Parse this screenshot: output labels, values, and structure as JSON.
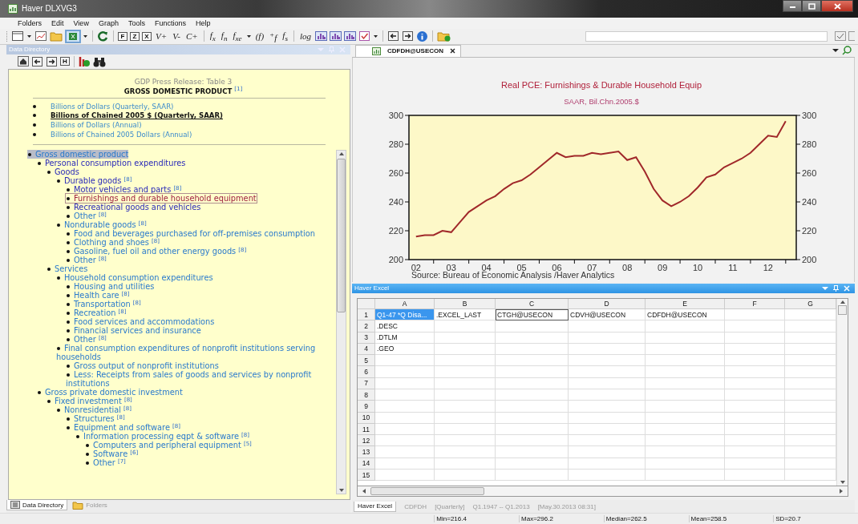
{
  "window": {
    "title": "Haver DLXVG3"
  },
  "menu": [
    "Folders",
    "Edit",
    "View",
    "Graph",
    "Tools",
    "Functions",
    "Help"
  ],
  "toolbar": [
    {
      "kind": "doc"
    },
    {
      "kind": "caret"
    },
    {
      "kind": "chart"
    },
    {
      "kind": "folder"
    },
    {
      "kind": "sheet"
    },
    {
      "kind": "caret"
    },
    {
      "kind": "sep"
    },
    {
      "kind": "refresh"
    },
    {
      "kind": "sep"
    },
    {
      "kind": "boxed",
      "label": "F"
    },
    {
      "kind": "boxed",
      "label": "Z"
    },
    {
      "kind": "boxed",
      "label": "X"
    },
    {
      "kind": "text",
      "label": "V+"
    },
    {
      "kind": "text",
      "label": "V-"
    },
    {
      "kind": "text",
      "label": "C+"
    },
    {
      "kind": "sep"
    },
    {
      "kind": "text",
      "label": "f$_{x}$"
    },
    {
      "kind": "text",
      "label": "f$_{n}$"
    },
    {
      "kind": "text",
      "label": "f$_{xe}$"
    },
    {
      "kind": "caret"
    },
    {
      "kind": "text",
      "label": "(f)"
    },
    {
      "kind": "text",
      "label": "$^{+}$f"
    },
    {
      "kind": "text",
      "label": "f$_{s}$"
    },
    {
      "kind": "sep"
    },
    {
      "kind": "text",
      "label": "log"
    },
    {
      "kind": "bars"
    },
    {
      "kind": "bars"
    },
    {
      "kind": "bars"
    },
    {
      "kind": "check"
    },
    {
      "kind": "caret"
    },
    {
      "kind": "sep"
    },
    {
      "kind": "left"
    },
    {
      "kind": "right"
    },
    {
      "kind": "info"
    },
    {
      "kind": "sep"
    },
    {
      "kind": "add-folder"
    }
  ],
  "data_directory": {
    "title": "Data Directory",
    "nav": [
      {
        "kind": "home"
      },
      {
        "kind": "left"
      },
      {
        "kind": "right"
      },
      {
        "kind": "boxed",
        "label": "H"
      },
      {
        "kind": "sep"
      },
      {
        "kind": "chart-add"
      },
      {
        "kind": "binoculars"
      }
    ],
    "release": "GDP Press Release: Table 3",
    "heading": "GROSS DOMESTIC PRODUCT $^{[1]}$",
    "units": [
      {
        "label": "Billions of Dollars (Quarterly, SAAR)",
        "selected": false
      },
      {
        "label": "Billions of Chained 2005 $ (Quarterly, SAAR)",
        "selected": true
      },
      {
        "label": "Billions of Dollars (Annual)",
        "selected": false
      },
      {
        "label": "Billions of Chained 2005 Dollars (Annual)",
        "selected": false
      }
    ],
    "tree": [
      {
        "label": "Gross domestic product",
        "selected": true,
        "current": false,
        "visited": false,
        "children": [
          {
            "label": "Personal consumption expenditures",
            "selected": false,
            "current": false,
            "visited": true,
            "children": [
              {
                "label": "Goods",
                "selected": false,
                "current": false,
                "visited": true,
                "children": [
                  {
                    "label": "Durable goods $^{[8]}$",
                    "selected": false,
                    "current": false,
                    "visited": true,
                    "children": [
                      {
                        "label": "Motor vehicles and parts $^{[8]}$",
                        "selected": false,
                        "current": false,
                        "visited": true
                      },
                      {
                        "label": "Furnishings and durable household equipment",
                        "selected": false,
                        "current": true,
                        "visited": true
                      },
                      {
                        "label": "Recreational goods and vehicles",
                        "selected": false,
                        "current": false,
                        "visited": true
                      },
                      {
                        "label": "Other $^{[8]}$",
                        "selected": false,
                        "current": false,
                        "visited": false
                      }
                    ]
                  },
                  {
                    "label": "Nondurable goods $^{[8]}$",
                    "selected": false,
                    "current": false,
                    "visited": false,
                    "children": [
                      {
                        "label": "Food and beverages purchased for off-premises consumption",
                        "selected": false,
                        "current": false,
                        "visited": false
                      },
                      {
                        "label": "Clothing and shoes $^{[8]}$",
                        "selected": false,
                        "current": false,
                        "visited": false
                      },
                      {
                        "label": "Gasoline, fuel oil and other energy goods $^{[8]}$",
                        "selected": false,
                        "current": false,
                        "visited": false
                      },
                      {
                        "label": "Other $^{[8]}$",
                        "selected": false,
                        "current": false,
                        "visited": false
                      }
                    ]
                  }
                ]
              },
              {
                "label": "Services",
                "selected": false,
                "current": false,
                "visited": false,
                "children": [
                  {
                    "label": "Household consumption expenditures",
                    "selected": false,
                    "current": false,
                    "visited": false,
                    "children": [
                      {
                        "label": "Housing and utilities",
                        "selected": false,
                        "current": false,
                        "visited": false
                      },
                      {
                        "label": "Health care $^{[8]}$",
                        "selected": false,
                        "current": false,
                        "visited": false
                      },
                      {
                        "label": "Transportation $^{[8]}$",
                        "selected": false,
                        "current": false,
                        "visited": false
                      },
                      {
                        "label": "Recreation $^{[8]}$",
                        "selected": false,
                        "current": false,
                        "visited": false
                      },
                      {
                        "label": "Food services and accommodations",
                        "selected": false,
                        "current": false,
                        "visited": false
                      },
                      {
                        "label": "Financial services and insurance",
                        "selected": false,
                        "current": false,
                        "visited": false
                      },
                      {
                        "label": "Other $^{[8]}$",
                        "selected": false,
                        "current": false,
                        "visited": false
                      }
                    ]
                  },
                  {
                    "label": "Final consumption expenditures of nonprofit institutions serving households",
                    "selected": false,
                    "current": false,
                    "visited": false,
                    "children": [
                      {
                        "label": "Gross output of nonprofit institutions",
                        "selected": false,
                        "current": false,
                        "visited": false
                      },
                      {
                        "label": "Less: Receipts from sales of goods and services by nonprofit institutions",
                        "selected": false,
                        "current": false,
                        "visited": false
                      }
                    ]
                  }
                ]
              }
            ]
          },
          {
            "label": "Gross private domestic investment",
            "selected": false,
            "current": false,
            "visited": false,
            "children": [
              {
                "label": "Fixed investment $^{[8]}$",
                "selected": false,
                "current": false,
                "visited": false,
                "children": [
                  {
                    "label": "Nonresidential $^{[8]}$",
                    "selected": false,
                    "current": false,
                    "visited": false,
                    "children": [
                      {
                        "label": "Structures $^{[8]}$",
                        "selected": false,
                        "current": false,
                        "visited": false
                      },
                      {
                        "label": "Equipment and software $^{[8]}$",
                        "selected": false,
                        "current": false,
                        "visited": false,
                        "children": [
                          {
                            "label": "Information processing eqpt & software $^{[8]}$",
                            "selected": false,
                            "current": false,
                            "visited": false,
                            "children": [
                              {
                                "label": "Computers and peripheral equipment $^{[5]}$",
                                "selected": false,
                                "current": false,
                                "visited": false
                              },
                              {
                                "label": "Software $^{[6]}$",
                                "selected": false,
                                "current": false,
                                "visited": false
                              },
                              {
                                "label": "Other $^{[7]}$",
                                "selected": false,
                                "current": false,
                                "visited": false
                              }
                            ]
                          }
                        ]
                      }
                    ]
                  }
                ]
              }
            ]
          }
        ]
      }
    ],
    "tabs": [
      {
        "label": "Data Directory",
        "kind": "list",
        "selected": true
      },
      {
        "label": "Folders",
        "kind": "folder",
        "selected": false
      }
    ]
  },
  "chart_tab": {
    "label": "CDFDH@USECON"
  },
  "chart": {
    "subtitle": "SAAR, Bil.Chn.2005.$",
    "source": "Source:  Bureau of Economic Analysis /Haver Analytics",
    "chart_data": {
      "type": "line",
      "title": "Real PCE: Furnishings & Durable Household Equip",
      "x": [
        2,
        2.25,
        2.5,
        2.75,
        3,
        3.25,
        3.5,
        3.75,
        4,
        4.25,
        4.5,
        4.75,
        5,
        5.25,
        5.5,
        5.75,
        6,
        6.25,
        6.5,
        6.75,
        7,
        7.25,
        7.5,
        7.75,
        8,
        8.25,
        8.5,
        8.75,
        9,
        9.25,
        9.5,
        9.75,
        10,
        10.25,
        10.5,
        10.75,
        11,
        11.25,
        11.5,
        11.75,
        12,
        12.25,
        12.5
      ],
      "series": [
        {
          "color": "#a0282a",
          "values": [
            216,
            217,
            217,
            220,
            219,
            226,
            233,
            237,
            241,
            244,
            249,
            253,
            255,
            259,
            264,
            269,
            274,
            271,
            272,
            272,
            274,
            273,
            274,
            275,
            269,
            271,
            261,
            249,
            241,
            237,
            240,
            244,
            250,
            257,
            259,
            264,
            267,
            270,
            274,
            280,
            286,
            285,
            296
          ]
        }
      ],
      "xlim": [
        1.8,
        12.8
      ],
      "ylim": [
        200,
        300
      ],
      "yticks": [
        200,
        220,
        240,
        260,
        280,
        300
      ],
      "y2lim": [
        200,
        300
      ],
      "y2ticks": [
        200,
        220,
        240,
        260,
        280,
        300
      ],
      "xticks": [
        {
          "value": 2,
          "label": "02"
        },
        {
          "value": 3,
          "label": "03"
        },
        {
          "value": 4,
          "label": "04"
        },
        {
          "value": 5,
          "label": "05"
        },
        {
          "value": 6,
          "label": "06"
        },
        {
          "value": 7,
          "label": "07"
        },
        {
          "value": 8,
          "label": "08"
        },
        {
          "value": 9,
          "label": "09"
        },
        {
          "value": 10,
          "label": "10"
        },
        {
          "value": 11,
          "label": "11"
        },
        {
          "value": 12,
          "label": "12"
        }
      ]
    }
  },
  "excel": {
    "title": "Haver Excel",
    "columns": [
      "A",
      "B",
      "C",
      "D",
      "E",
      "F",
      "G"
    ],
    "rows": [
      {
        "header": "1",
        "cells": [
          {
            "text": "Q1-47 *Q Disa...",
            "selected": true,
            "focused": false
          },
          {
            "text": ".EXCEL_LAST",
            "selected": false,
            "focused": false
          },
          {
            "text": "CTGH@USECON",
            "selected": false,
            "focused": true
          },
          {
            "text": "CDVH@USECON",
            "selected": false,
            "focused": false
          },
          {
            "text": "CDFDH@USECON",
            "selected": false,
            "focused": false
          }
        ]
      },
      {
        "header": "2",
        "cells": [
          {
            "text": ".DESC",
            "selected": false,
            "focused": false
          }
        ]
      },
      {
        "header": "3",
        "cells": [
          {
            "text": ".DTLM",
            "selected": false,
            "focused": false
          }
        ]
      },
      {
        "header": "4",
        "cells": [
          {
            "text": ".GEO",
            "selected": false,
            "focused": false
          }
        ]
      },
      {
        "header": "5"
      },
      {
        "header": "6"
      },
      {
        "header": "7"
      },
      {
        "header": "8"
      },
      {
        "header": "9"
      },
      {
        "header": "10"
      },
      {
        "header": "11"
      },
      {
        "header": "12"
      },
      {
        "header": "13"
      },
      {
        "header": "14"
      },
      {
        "header": "15"
      }
    ],
    "tabs": [
      {
        "label": "Haver Excel",
        "selected": true
      }
    ],
    "info": [
      "CDFDH",
      "[Quarterly]",
      "Q1.1947 -- Q1.2013",
      "[May.30.2013 08:31]"
    ]
  },
  "status_bar": [
    "Min=216.4",
    "Max=296.2",
    "Median=262.5",
    "Mean=258.5",
    "SD=20.7"
  ]
}
